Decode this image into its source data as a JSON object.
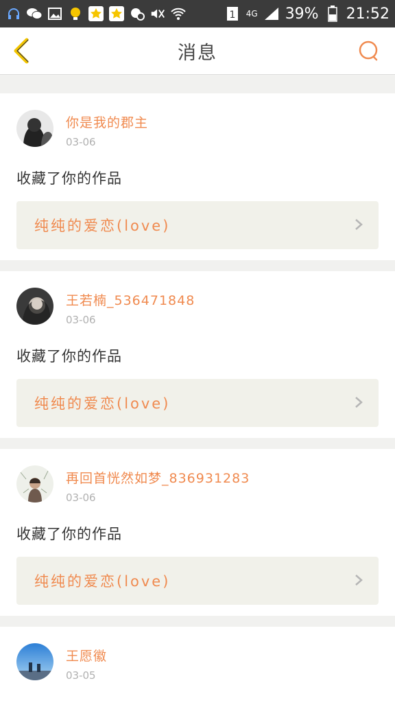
{
  "status_bar": {
    "battery": "39%",
    "time": "21:52",
    "network": "4G",
    "sim": "1",
    "icons": [
      "headset-icon",
      "wechat-icon",
      "image-icon",
      "bulb-icon",
      "star-app-icon",
      "star-app-icon",
      "message-icon",
      "mute-icon",
      "wifi-icon",
      "sim-icon",
      "signal-icon",
      "battery-icon"
    ]
  },
  "header": {
    "title": "消息",
    "back_icon": "chevron-left-icon",
    "search_icon": "search-icon"
  },
  "colors": {
    "accent": "#f08a4f",
    "back_accent": "#f3c500"
  },
  "messages": [
    {
      "user": "你是我的郡主",
      "date": "03-06",
      "action": "收藏了你的作品",
      "work": "纯纯的爱恋(love)"
    },
    {
      "user": "王若楠_536471848",
      "date": "03-06",
      "action": "收藏了你的作品",
      "work": "纯纯的爱恋(love)"
    },
    {
      "user": "再回首恍然如梦_836931283",
      "date": "03-06",
      "action": "收藏了你的作品",
      "work": "纯纯的爱恋(love)"
    },
    {
      "user": "王愿徽",
      "date": "03-05"
    }
  ]
}
